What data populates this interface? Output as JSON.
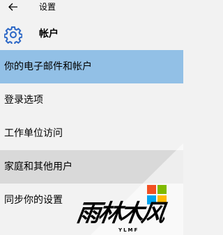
{
  "window": {
    "title": "设置"
  },
  "header": {
    "title": "帐户",
    "icon": "gear-icon",
    "icon_color": "#2b66c6"
  },
  "nav": {
    "items": [
      {
        "label": "你的电子邮件和帐户",
        "state": "selected"
      },
      {
        "label": "登录选项",
        "state": "normal"
      },
      {
        "label": "工作单位访问",
        "state": "normal"
      },
      {
        "label": "家庭和其他用户",
        "state": "hover"
      },
      {
        "label": "同步你的设置",
        "state": "normal"
      }
    ]
  },
  "colors": {
    "background": "#f2f2f2",
    "selected": "#92c0e6",
    "hover": "#d9d9d9"
  },
  "watermark": {
    "text": "雨林木风",
    "sub": "YLMF",
    "logo_colors": [
      "#f25022",
      "#7fba00",
      "#00a4ef",
      "#ffb900"
    ]
  }
}
